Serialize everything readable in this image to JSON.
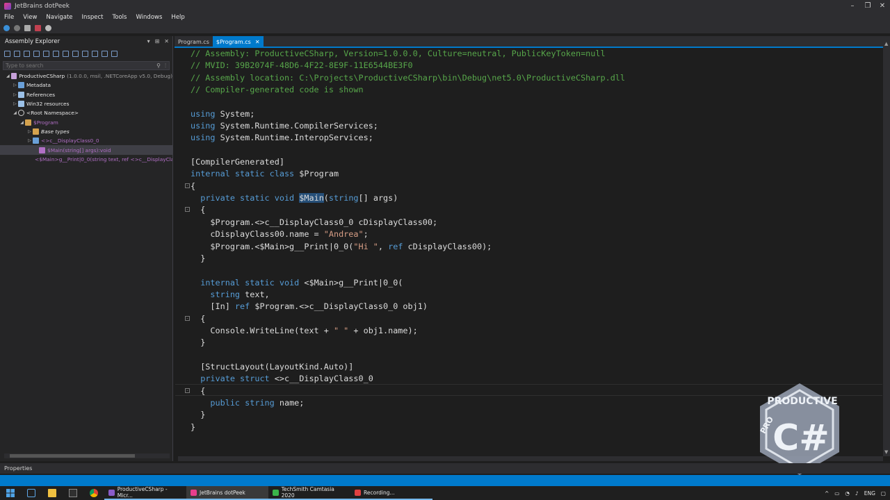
{
  "window": {
    "title": "JetBrains dotPeek",
    "controls": {
      "minimize": "–",
      "maximize": "❐",
      "close": "✕"
    }
  },
  "menu": [
    "File",
    "View",
    "Navigate",
    "Inspect",
    "Tools",
    "Windows",
    "Help"
  ],
  "assembly_explorer": {
    "title": "Assembly Explorer",
    "header_controls": [
      "▾",
      "⊞",
      "✕"
    ],
    "search_placeholder": "Type to search",
    "tree": [
      {
        "label": "ProductiveCSharp",
        "meta": "(1.0.0.0, msil, .NETCoreApp v5.0, Debug)",
        "arrow": "◢",
        "icon_color": "#c6a0d9"
      },
      {
        "label": "Metadata",
        "meta": "",
        "arrow": "▷",
        "icon_color": "#6aa0d8"
      },
      {
        "label": "References",
        "meta": "",
        "arrow": "▷",
        "icon_color": "#9cc1e8"
      },
      {
        "label": "Win32 resources",
        "meta": "",
        "arrow": "▷",
        "icon_color": "#9cc1e8"
      },
      {
        "label": "<Root Namespace>",
        "meta": "",
        "arrow": "◢",
        "icon_color": "#d0d0d0"
      },
      {
        "label": "$Program",
        "meta": "",
        "arrow": "◢",
        "icon_color": "#d4a24e"
      },
      {
        "label": "Base types",
        "meta": "",
        "arrow": "▷",
        "icon_color": "#d4a24e"
      },
      {
        "label": "<>c__DisplayClass0_0",
        "meta": "",
        "arrow": "▷",
        "icon_color": "#6aa0d8"
      },
      {
        "label": "$Main(string[] args):void",
        "meta": "",
        "arrow": "",
        "icon_color": "#b16fc5"
      },
      {
        "label": "<$Main>g__Print|0_0(string text, ref <>c__DisplayCla",
        "meta": "",
        "arrow": "",
        "icon_color": "#b16fc5"
      }
    ]
  },
  "tabs": [
    {
      "label": "Program.cs",
      "active": false,
      "close": ""
    },
    {
      "label": "$Program.cs",
      "active": true,
      "close": "✕"
    }
  ],
  "code_lines": [
    {
      "tokens": [
        {
          "t": "// Assembly: ProductiveCSharp, Version=1.0.0.0, Culture=neutral, PublicKeyToken=null",
          "c": "cm"
        }
      ]
    },
    {
      "tokens": [
        {
          "t": "// MVID: 39B2074F-48D6-4F22-8E9F-11E6544BE3F0",
          "c": "cm"
        }
      ]
    },
    {
      "tokens": [
        {
          "t": "// Assembly location: C:\\Projects\\ProductiveCSharp\\bin\\Debug\\net5.0\\ProductiveCSharp.dll",
          "c": "cm"
        }
      ]
    },
    {
      "tokens": [
        {
          "t": "// Compiler-generated code is shown",
          "c": "cm"
        }
      ]
    },
    {
      "tokens": []
    },
    {
      "tokens": [
        {
          "t": "using",
          "c": "kw"
        },
        {
          "t": " System;",
          "c": ""
        }
      ]
    },
    {
      "tokens": [
        {
          "t": "using",
          "c": "kw"
        },
        {
          "t": " System.Runtime.CompilerServices;",
          "c": ""
        }
      ]
    },
    {
      "tokens": [
        {
          "t": "using",
          "c": "kw"
        },
        {
          "t": " System.Runtime.InteropServices;",
          "c": ""
        }
      ]
    },
    {
      "tokens": []
    },
    {
      "tokens": [
        {
          "t": "[CompilerGenerated]",
          "c": ""
        }
      ]
    },
    {
      "tokens": [
        {
          "t": "internal static class",
          "c": "kw"
        },
        {
          "t": " $Program",
          "c": ""
        }
      ]
    },
    {
      "tokens": [
        {
          "t": "{",
          "c": ""
        }
      ]
    },
    {
      "tokens": [
        {
          "t": "  ",
          "c": ""
        },
        {
          "t": "private static void",
          "c": "kw"
        },
        {
          "t": " ",
          "c": ""
        },
        {
          "t": "$Main",
          "c": "hl"
        },
        {
          "t": "(",
          "c": ""
        },
        {
          "t": "string",
          "c": "kw"
        },
        {
          "t": "[] args)",
          "c": ""
        }
      ]
    },
    {
      "tokens": [
        {
          "t": "  {",
          "c": ""
        }
      ]
    },
    {
      "tokens": [
        {
          "t": "    $Program.<>c__DisplayClass0_0 cDisplayClass00;",
          "c": ""
        }
      ]
    },
    {
      "tokens": [
        {
          "t": "    cDisplayClass00.name = ",
          "c": ""
        },
        {
          "t": "\"Andrea\"",
          "c": "str"
        },
        {
          "t": ";",
          "c": ""
        }
      ]
    },
    {
      "tokens": [
        {
          "t": "    $Program.<$Main>g__Print|0_0(",
          "c": ""
        },
        {
          "t": "\"Hi \"",
          "c": "str"
        },
        {
          "t": ", ",
          "c": ""
        },
        {
          "t": "ref",
          "c": "kw"
        },
        {
          "t": " cDisplayClass00);",
          "c": ""
        }
      ]
    },
    {
      "tokens": [
        {
          "t": "  }",
          "c": ""
        }
      ]
    },
    {
      "tokens": []
    },
    {
      "tokens": [
        {
          "t": "  ",
          "c": ""
        },
        {
          "t": "internal static void",
          "c": "kw"
        },
        {
          "t": " <$Main>g__Print|0_0(",
          "c": ""
        }
      ]
    },
    {
      "tokens": [
        {
          "t": "    ",
          "c": ""
        },
        {
          "t": "string",
          "c": "kw"
        },
        {
          "t": " text,",
          "c": ""
        }
      ]
    },
    {
      "tokens": [
        {
          "t": "    [In] ",
          "c": ""
        },
        {
          "t": "ref",
          "c": "kw"
        },
        {
          "t": " $Program.<>c__DisplayClass0_0 obj1)",
          "c": ""
        }
      ]
    },
    {
      "tokens": [
        {
          "t": "  {",
          "c": ""
        }
      ]
    },
    {
      "tokens": [
        {
          "t": "    Console.WriteLine(text + ",
          "c": ""
        },
        {
          "t": "\" \"",
          "c": "str"
        },
        {
          "t": " + obj1.name);",
          "c": ""
        }
      ]
    },
    {
      "tokens": [
        {
          "t": "  }",
          "c": ""
        }
      ]
    },
    {
      "tokens": []
    },
    {
      "tokens": [
        {
          "t": "  [StructLayout(LayoutKind.Auto)]",
          "c": ""
        }
      ]
    },
    {
      "tokens": [
        {
          "t": "  ",
          "c": ""
        },
        {
          "t": "private struct",
          "c": "kw"
        },
        {
          "t": " <>c__DisplayClass0_0",
          "c": ""
        }
      ]
    },
    {
      "tokens": [
        {
          "t": "  {",
          "c": ""
        }
      ]
    },
    {
      "tokens": [
        {
          "t": "    ",
          "c": ""
        },
        {
          "t": "public string",
          "c": "kw"
        },
        {
          "t": " name;",
          "c": ""
        }
      ]
    },
    {
      "tokens": [
        {
          "t": "  }",
          "c": ""
        }
      ]
    },
    {
      "tokens": [
        {
          "t": "}",
          "c": ""
        }
      ]
    }
  ],
  "logo": {
    "top_text": "PRODUCTIVE",
    "left_text": "PRO",
    "symbol": "C#"
  },
  "properties_label": "Properties",
  "taskbar": {
    "apps": [
      {
        "label": "ProductiveCSharp - Micr...",
        "color": "#8a5cc8",
        "active": false
      },
      {
        "label": "JetBrains dotPeek",
        "color": "#e83e8c",
        "active": true
      },
      {
        "label": "TechSmith Camtasia 2020",
        "color": "#3ab54a",
        "active": false
      },
      {
        "label": "Recording...",
        "color": "#e04040",
        "active": false
      }
    ],
    "tray_lang": "ENG",
    "tray_icons": [
      "^",
      "▭",
      "◔",
      "♪"
    ]
  },
  "colors": {
    "accent": "#007acc",
    "keyword": "#569cd6",
    "comment": "#57a64a",
    "string": "#d69d85"
  }
}
